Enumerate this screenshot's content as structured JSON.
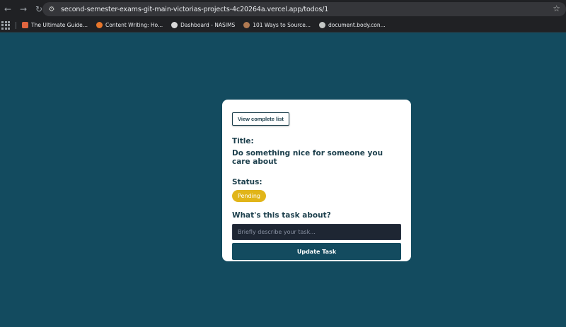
{
  "browser": {
    "url": "second-semester-exams-git-main-victorias-projects-4c20264a.vercel.app/todos/1",
    "back_icon": "arrow-left-icon",
    "forward_icon": "arrow-right-icon",
    "reload_icon": "reload-icon",
    "bookmarks": [
      {
        "label": "The Ultimate Guide...",
        "icon_color": "#e0653f"
      },
      {
        "label": "Content Writing: Ho...",
        "icon_color": "#e8762b"
      },
      {
        "label": "Dashboard - NASIMS",
        "icon_color": "#d9d9d9"
      },
      {
        "label": "101 Ways to Source...",
        "icon_color": "#b07a52"
      },
      {
        "label": "document.body.con...",
        "icon_color": "#c4c7c5"
      }
    ]
  },
  "todo": {
    "view_list_label": "View complete list",
    "title_label": "Title:",
    "title_value": "Do something nice for someone you care about",
    "status_label": "Status:",
    "status_value": "Pending",
    "about_label": "What's this task about?",
    "description_placeholder": "Briefly describe your task...",
    "update_label": "Update Task"
  },
  "colors": {
    "page_background": "#134b5f",
    "card_background": "#ffffff",
    "text": "#1b3e4b",
    "status_badge": "#e1b519",
    "input_background": "#1e2633",
    "update_button": "#134b5f"
  }
}
